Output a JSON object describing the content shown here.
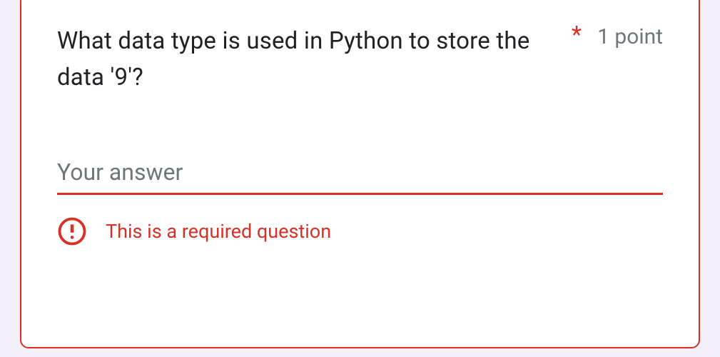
{
  "question": {
    "text": "What data type is used in Python to store the data '9'?",
    "required_marker": "*",
    "points_label": "1 point"
  },
  "answer": {
    "placeholder": "Your answer",
    "value": ""
  },
  "error": {
    "message": "This is a required question"
  }
}
